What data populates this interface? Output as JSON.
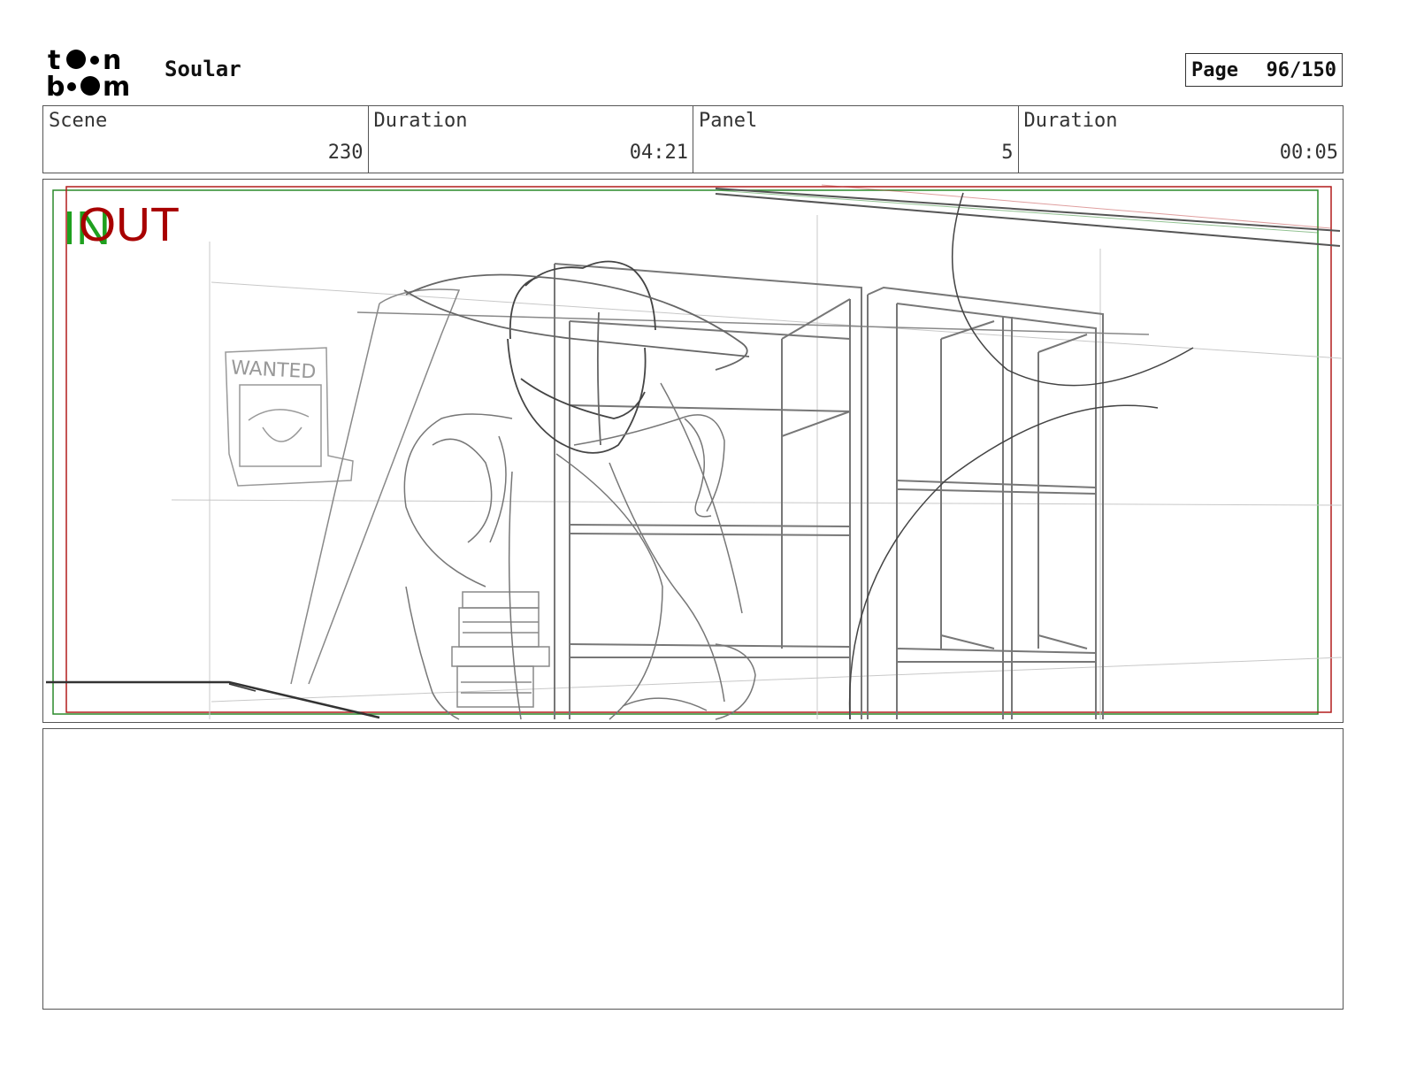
{
  "header": {
    "logo_text_line1": "toon",
    "logo_text_line2": "boom",
    "project_title": "Soular",
    "page_label": "Page",
    "page_number": "96/150"
  },
  "info": {
    "scene_label": "Scene",
    "scene_value": "230",
    "scene_duration_label": "Duration",
    "scene_duration_value": "04:21",
    "panel_label": "Panel",
    "panel_value": "5",
    "panel_duration_label": "Duration",
    "panel_duration_value": "00:05"
  },
  "panel": {
    "in_label": "IN",
    "out_label": "OUT",
    "poster_text": "WANTED",
    "in_color": "#1fa01f",
    "out_color": "#a80000"
  },
  "notes": {
    "text": ""
  }
}
